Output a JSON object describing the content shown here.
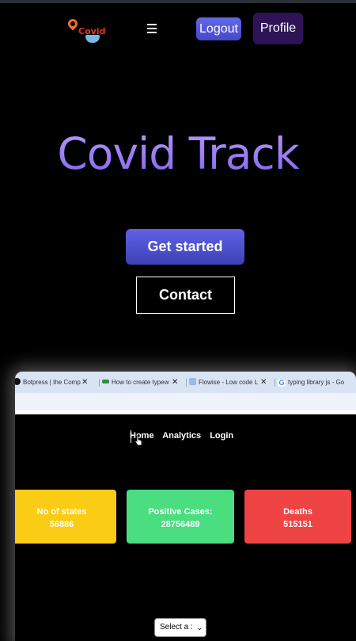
{
  "navbar": {
    "logo_text": "Covid",
    "menu_icon": "hamburger-menu-icon",
    "logout_label": "Logout",
    "profile_label": "Profile"
  },
  "hero": {
    "title": "Covid Track",
    "get_started_label": "Get started",
    "contact_label": "Contact"
  },
  "preview": {
    "tabs": [
      {
        "title": "Botpress | the Comp",
        "icon": "botpress-icon"
      },
      {
        "title": "How to create typew",
        "icon": "geeksforgeeks-icon"
      },
      {
        "title": "Flowise - Low code L",
        "icon": "flowise-icon"
      },
      {
        "title": "typing library js - Go",
        "icon": "google-icon"
      }
    ],
    "nav": {
      "home": "Home",
      "analytics": "Analytics",
      "login": "Login"
    },
    "cards": [
      {
        "label": "No of states",
        "value": "56886",
        "color": "#facc15"
      },
      {
        "label": "Positive Cases:",
        "value": "28756489",
        "color": "#4ade80"
      },
      {
        "label": "Deaths",
        "value": "515151",
        "color": "#ef4444"
      }
    ],
    "select_placeholder": "Select a :"
  },
  "colors": {
    "background": "#000000",
    "accent": "#5f62e4",
    "title_gradient_top": "#b79bff",
    "title_gradient_bottom": "#8262ea",
    "profile_bg": "#2e1456"
  }
}
